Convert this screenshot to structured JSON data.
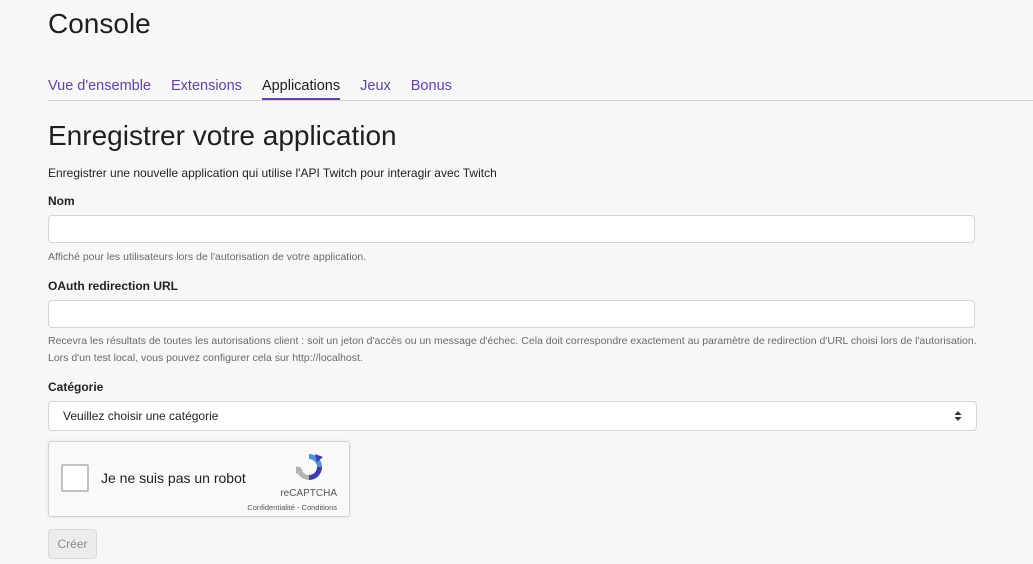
{
  "header": {
    "title": "Console"
  },
  "tabs": [
    {
      "label": "Vue d'ensemble",
      "active": false
    },
    {
      "label": "Extensions",
      "active": false
    },
    {
      "label": "Applications",
      "active": true
    },
    {
      "label": "Jeux",
      "active": false
    },
    {
      "label": "Bonus",
      "active": false
    }
  ],
  "form": {
    "title": "Enregistrer votre application",
    "intro": "Enregistrer une nouvelle application qui utilise l'API Twitch pour interagir avec Twitch",
    "name": {
      "label": "Nom",
      "value": "",
      "help": "Affiché pour les utilisateurs lors de l'autorisation de votre application."
    },
    "redirect": {
      "label": "OAuth redirection URL",
      "value": "",
      "help": "Recevra les résultats de toutes les autorisations client : soit un jeton d'accès ou un message d'échec. Cela doit correspondre exactement au paramètre de redirection d'URL choisi lors de l'autorisation. Lors d'un test local, vous pouvez configurer cela sur http://localhost."
    },
    "category": {
      "label": "Catégorie",
      "selected": "Veuillez choisir une catégorie"
    },
    "recaptcha": {
      "label": "Je ne suis pas un robot",
      "brand": "reCAPTCHA",
      "privacy": "Confidentialité",
      "separator": " - ",
      "terms": "Conditions"
    },
    "submit_label": "Créer"
  },
  "colors": {
    "accent": "#6441a4",
    "background": "#f7f7f7"
  }
}
